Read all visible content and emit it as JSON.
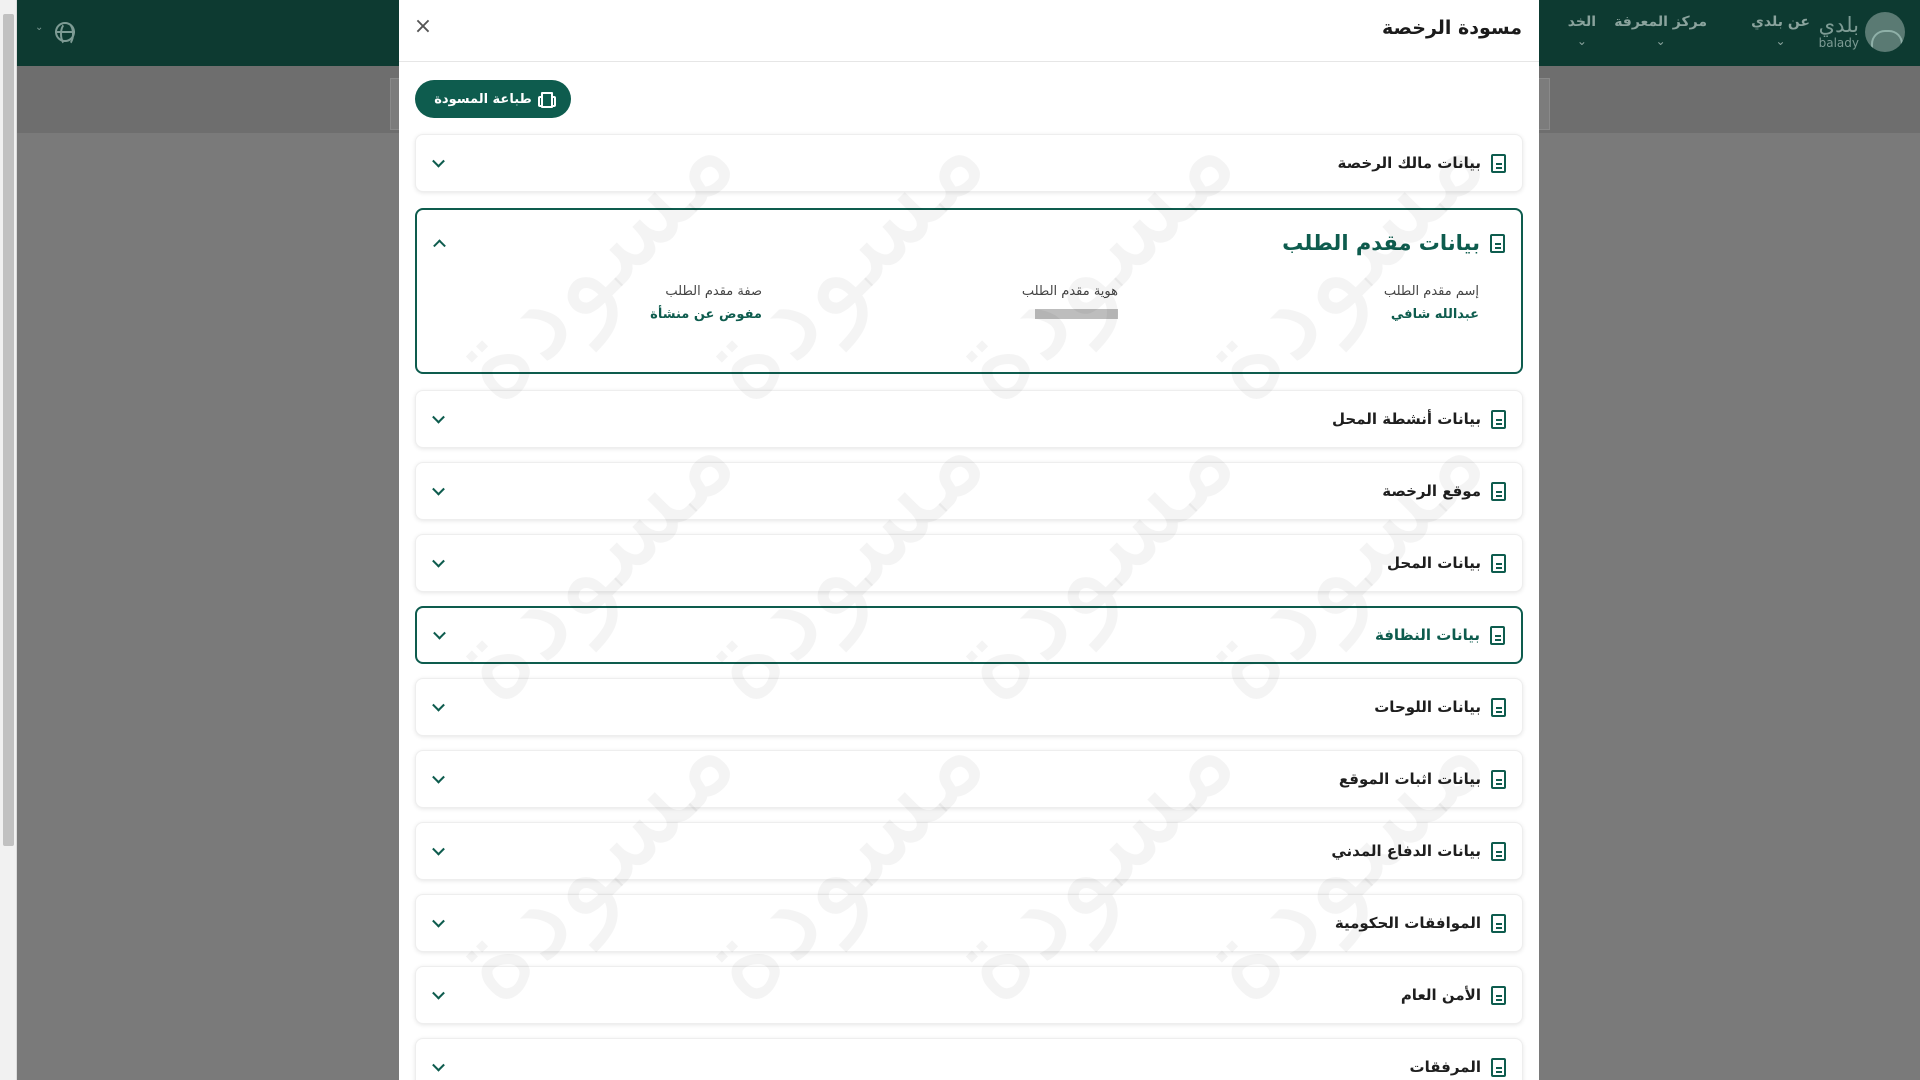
{
  "header": {
    "logo_ar": "بلدي",
    "logo_en": "balady",
    "nav": [
      {
        "label": "عن بلدي"
      },
      {
        "label": "مركز المعرفة"
      },
      {
        "label": "الخد"
      }
    ]
  },
  "modal": {
    "title": "مسودة الرخصة",
    "close_glyph": "×",
    "print_label": "طباعة المسودة",
    "watermark": "مسودة"
  },
  "sections": [
    {
      "title": "بيانات مالك الرخصة"
    },
    {
      "title": "بيانات مقدم الطلب",
      "fields": [
        {
          "label": "إسم مقدم الطلب",
          "value": "عبدالله شافي"
        },
        {
          "label": "هوية مقدم الطلب",
          "value": ""
        },
        {
          "label": "صفة مقدم الطلب",
          "value": "مفوض عن منشأة"
        }
      ]
    },
    {
      "title": "بيانات أنشطة المحل"
    },
    {
      "title": "موقع الرخصة"
    },
    {
      "title": "بيانات المحل"
    },
    {
      "title": "بيانات النظافة"
    },
    {
      "title": "بيانات اللوحات"
    },
    {
      "title": "بيانات اثبات الموقع"
    },
    {
      "title": "بيانات الدفاع المدني"
    },
    {
      "title": "الموافقات الحكومية"
    },
    {
      "title": "الأمن العام"
    },
    {
      "title": "المرفقات"
    }
  ]
}
